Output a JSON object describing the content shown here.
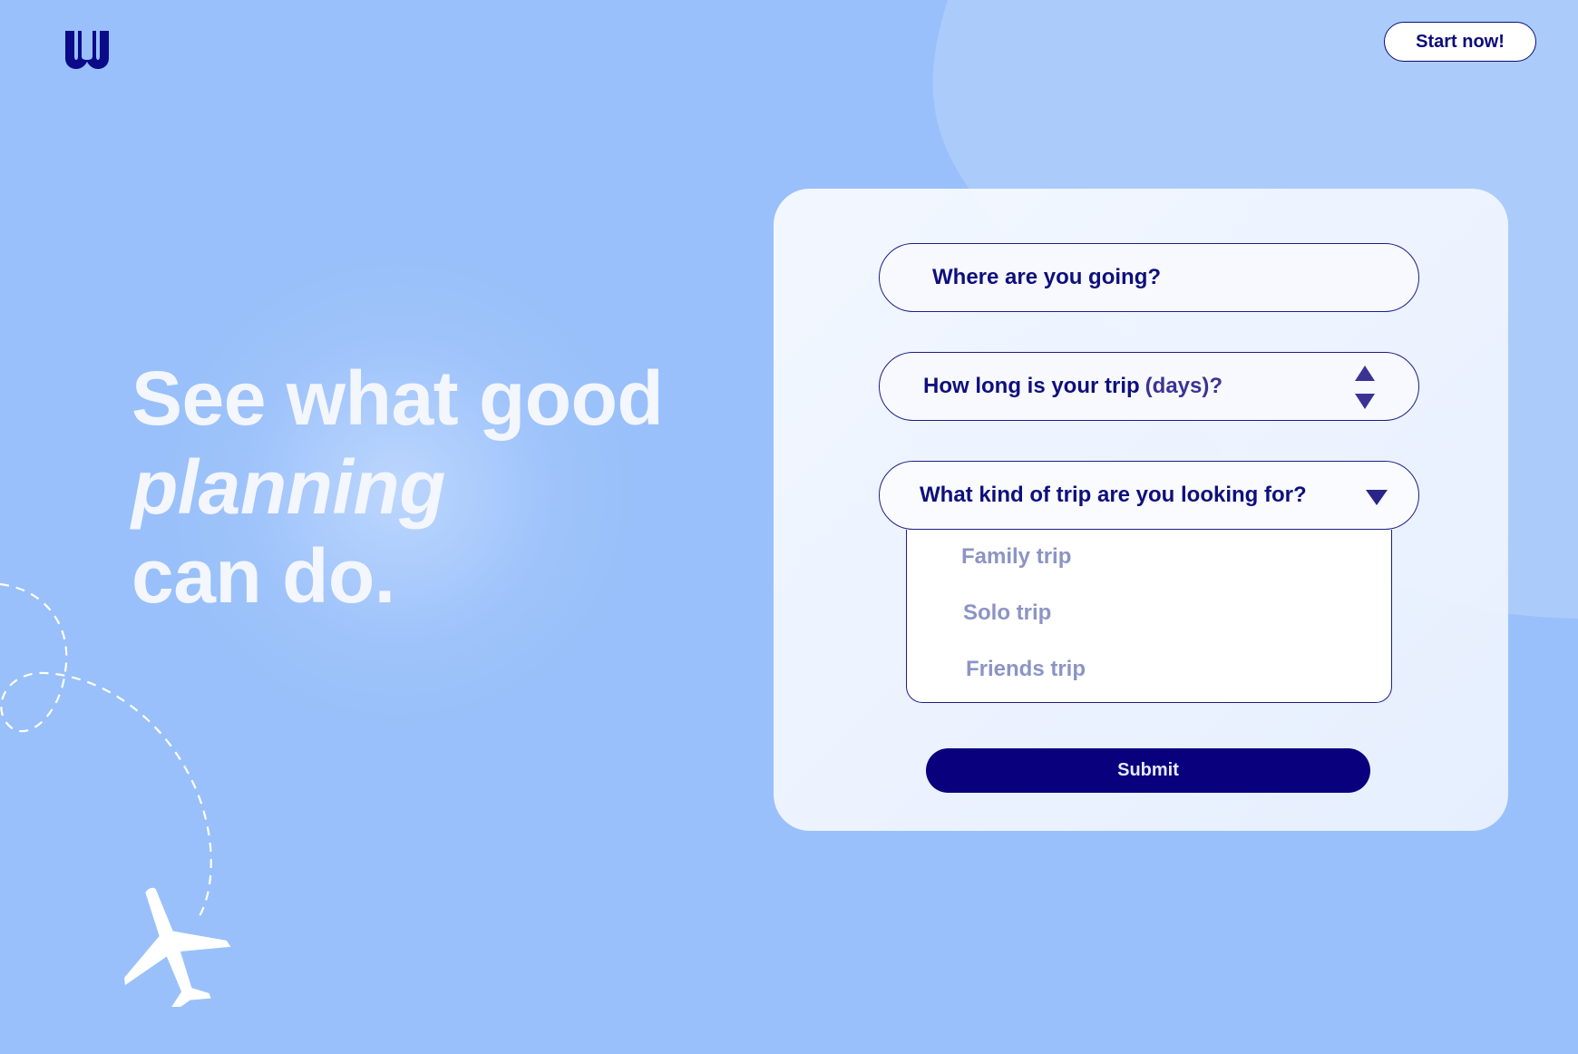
{
  "header": {
    "logo_icon": "w-logo-icon",
    "start_button_label": "Start now!"
  },
  "hero": {
    "line1": "See what good",
    "line2": "planning",
    "line3": "can do."
  },
  "form": {
    "destination_placeholder": "Where are you going?",
    "duration_label_main": "How long is your trip",
    "duration_label_unit": "(days)?",
    "trip_type_label": "What kind of trip are you looking for?",
    "trip_type_options": [
      "Family trip",
      "Solo trip",
      "Friends trip"
    ],
    "submit_label": "Submit"
  },
  "decor": {
    "airplane_icon": "airplane-icon"
  },
  "colors": {
    "background": "#99c0fa",
    "accent": "#08007d",
    "text_dark": "#0f0f7c",
    "option_text": "#8b94c4",
    "headline": "#f3f6fd"
  }
}
